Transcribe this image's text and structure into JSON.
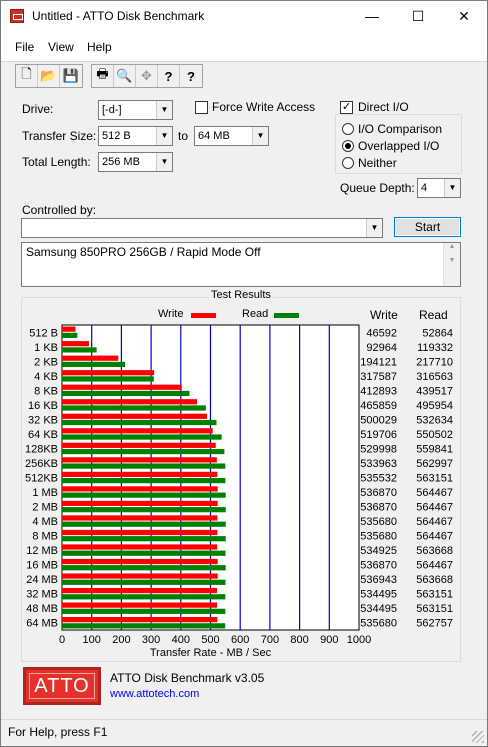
{
  "window": {
    "title": "Untitled - ATTO Disk Benchmark",
    "minimize_glyph": "—",
    "maximize_glyph": "☐",
    "close_glyph": "✕"
  },
  "menu": [
    "File",
    "View",
    "Help"
  ],
  "toolbar": {
    "icons": [
      "new-document-icon",
      "open-folder-icon",
      "save-icon",
      "print-icon",
      "print-preview-icon",
      "move-icon",
      "help-icon",
      "context-help-icon"
    ],
    "glyphs": [
      "🗋",
      "📂",
      "💾",
      "🖶",
      "🔍",
      "✥",
      "?",
      "?"
    ]
  },
  "settings": {
    "drive_label": "Drive:",
    "drive_value": "[-d-]",
    "force_write_label": "Force Write Access",
    "force_write_checked": false,
    "direct_io_label": "Direct I/O",
    "direct_io_checked": true,
    "transfer_size_label": "Transfer Size:",
    "transfer_from": "512 B",
    "to_label": "to",
    "transfer_to": "64 MB",
    "total_length_label": "Total Length:",
    "total_length": "256 MB",
    "io_comparison_label": "I/O Comparison",
    "overlapped_io_label": "Overlapped I/O",
    "neither_label": "Neither",
    "selected_mode": "Overlapped I/O",
    "queue_depth_label": "Queue Depth:",
    "queue_depth": "4",
    "controlled_by_label": "Controlled by:",
    "controlled_by_value": "",
    "start_label": "Start",
    "description": "Samsung 850PRO 256GB / Rapid Mode Off",
    "check_glyph": "✓"
  },
  "results": {
    "title": "Test Results",
    "write_legend": "Write",
    "read_legend": "Read",
    "write_col": "Write",
    "read_col": "Read",
    "write_color": "#ff0000",
    "read_color": "#008000"
  },
  "chart_data": {
    "type": "bar",
    "orientation": "horizontal",
    "categories": [
      "512 B",
      "1 KB",
      "2 KB",
      "4 KB",
      "8 KB",
      "16 KB",
      "32 KB",
      "64 KB",
      "128KB",
      "256KB",
      "512KB",
      "1 MB",
      "2 MB",
      "4 MB",
      "8 MB",
      "12 MB",
      "16 MB",
      "24 MB",
      "32 MB",
      "48 MB",
      "64 MB"
    ],
    "series": [
      {
        "name": "Write",
        "values": [
          46592,
          92964,
          194121,
          317587,
          412893,
          465859,
          500029,
          519706,
          529998,
          533963,
          535532,
          536870,
          536870,
          535680,
          535680,
          534925,
          536870,
          536943,
          534495,
          534495,
          535680
        ]
      },
      {
        "name": "Read",
        "values": [
          52864,
          119332,
          217710,
          316563,
          439517,
          495954,
          532634,
          550502,
          559841,
          562997,
          563151,
          564467,
          564467,
          564467,
          564467,
          563668,
          564467,
          563668,
          563151,
          563151,
          562757
        ]
      }
    ],
    "write_text": [
      "46592",
      "92964",
      "194121",
      "317587",
      "412893",
      "465859",
      "500029",
      "519706",
      "529998",
      "533963",
      "535532",
      "536870",
      "536870",
      "535680",
      "535680",
      "534925",
      "536870",
      "536943",
      "534495",
      "534495",
      "535680"
    ],
    "read_text": [
      "52864",
      "119332",
      "217710",
      "316563",
      "439517",
      "495954",
      "532634",
      "550502",
      "559841",
      "562997",
      "563151",
      "564467",
      "564467",
      "564467",
      "564467",
      "563668",
      "564467",
      "563668",
      "563151",
      "563151",
      "562757"
    ],
    "xlabel": "Transfer Rate - MB / Sec",
    "x_ticks": [
      "0",
      "100",
      "200",
      "300",
      "400",
      "500",
      "600",
      "700",
      "800",
      "900",
      "1000"
    ],
    "xlim": [
      0,
      1000
    ],
    "grid": true,
    "grid_color": "#0000cc"
  },
  "footer": {
    "logo_text": "ATTO",
    "app_version": "ATTO Disk Benchmark v3.05",
    "website": "www.attotech.com"
  },
  "status": {
    "text": "For Help, press F1"
  }
}
